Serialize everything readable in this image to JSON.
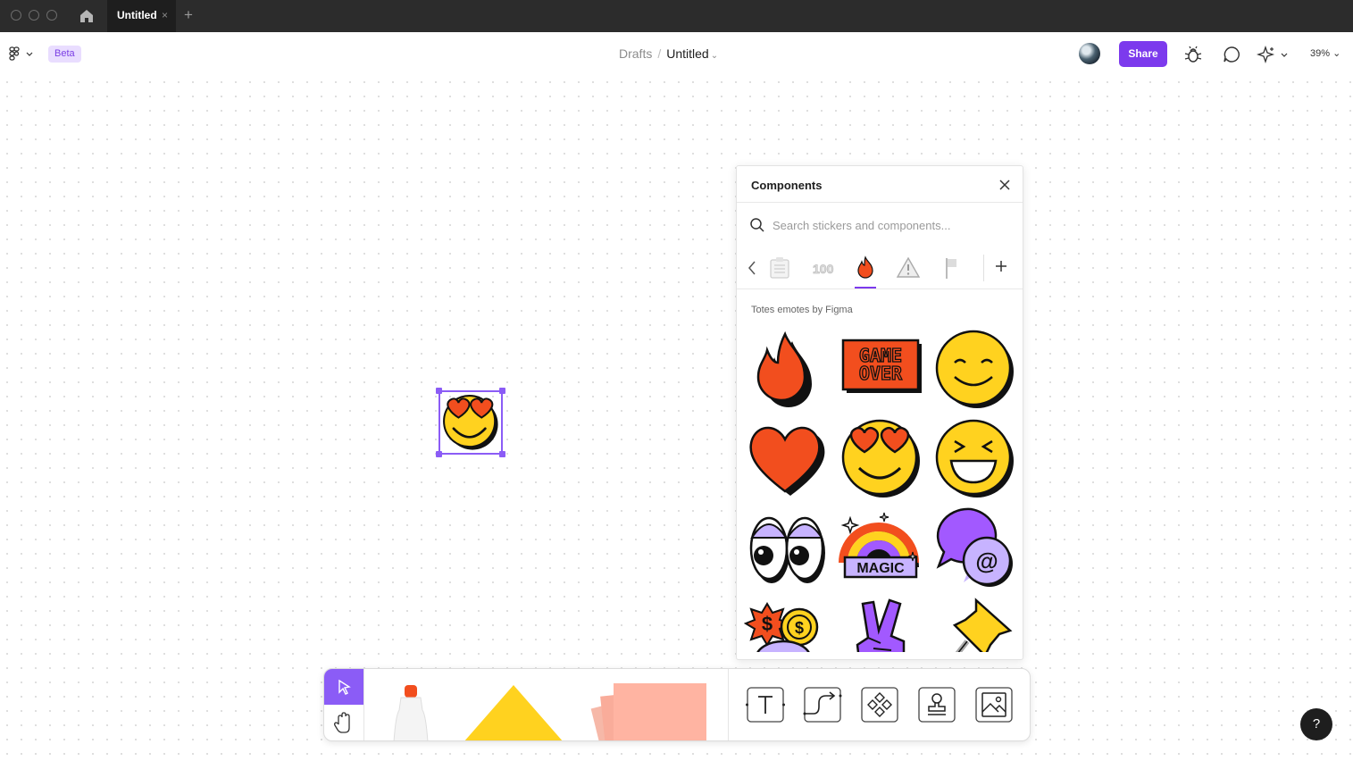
{
  "window": {
    "tab_title": "Untitled",
    "tab_close": "×",
    "new_tab": "+"
  },
  "toolbar": {
    "badge": "Beta",
    "breadcrumb": {
      "parent": "Drafts",
      "separator": "/",
      "file": "Untitled"
    },
    "share_label": "Share",
    "zoom_level": "39%"
  },
  "components_panel": {
    "title": "Components",
    "search_placeholder": "Search stickers and components...",
    "categories": [
      "notepad-icon",
      "numbers-icon",
      "fire-icon",
      "warning-icon",
      "flag-icon"
    ],
    "active_category": "fire-icon",
    "section_title": "Totes emotes by Figma",
    "stickers": [
      {
        "name": "fire-sticker",
        "text": ""
      },
      {
        "name": "game-over-sticker",
        "line1": "GAME",
        "line2": "OVER"
      },
      {
        "name": "smile-sticker",
        "text": ""
      },
      {
        "name": "heart-sticker",
        "text": ""
      },
      {
        "name": "heart-eyes-sticker",
        "text": ""
      },
      {
        "name": "laughing-sticker",
        "text": ""
      },
      {
        "name": "eyes-sticker",
        "text": ""
      },
      {
        "name": "magic-rainbow-sticker",
        "text": "MAGIC"
      },
      {
        "name": "mention-bubble-sticker",
        "text": "@"
      },
      {
        "name": "money-sticker",
        "text": "$"
      },
      {
        "name": "peace-hand-sticker",
        "text": ""
      },
      {
        "name": "pushpin-sticker",
        "text": ""
      }
    ]
  },
  "bottom_toolbar": {
    "tools": [
      "move-tool",
      "hand-tool",
      "marker-tool",
      "shape-tool",
      "sticky-note-tool",
      "text-tool",
      "connector-tool",
      "component-tool",
      "stamp-tool",
      "image-tool"
    ]
  },
  "help_label": "?",
  "colors": {
    "accent": "#7c3aed",
    "selection": "#8b5cf6",
    "sticker_yellow": "#ffd21f",
    "sticker_red": "#f24e1e",
    "sticker_purple": "#a259ff",
    "sticky_note": "#ffb4a2"
  }
}
